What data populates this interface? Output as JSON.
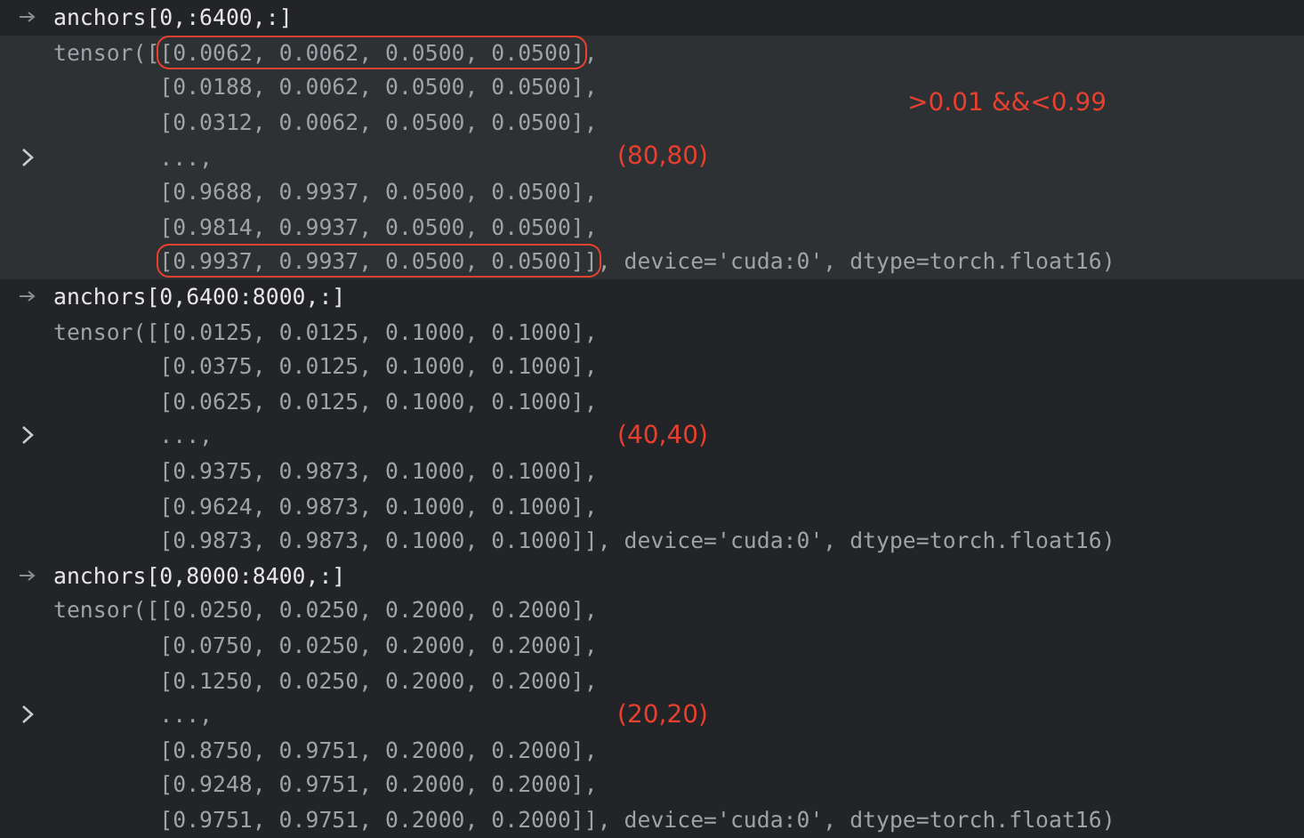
{
  "cells": [
    {
      "input": "anchors[0,:6400,:]",
      "selected": true,
      "side_note": ">0.01 &&<0.99",
      "lines": [
        {
          "lead": "tensor([",
          "body": "[0.0062, 0.0062, 0.0500, 0.0500]",
          "tail": ",",
          "boxed": true
        },
        {
          "body": "[0.0188, 0.0062, 0.0500, 0.0500]",
          "tail": ",",
          "boxed": false
        },
        {
          "body": "[0.0312, 0.0062, 0.0500, 0.0500]",
          "tail": ",",
          "boxed": false
        },
        {
          "body": "...,",
          "boxed": false,
          "expander": true,
          "note": "(80,80)"
        },
        {
          "body": "[0.9688, 0.9937, 0.0500, 0.0500]",
          "tail": ",",
          "boxed": false
        },
        {
          "body": "[0.9814, 0.9937, 0.0500, 0.0500]",
          "tail": ",",
          "boxed": false
        },
        {
          "body": "[0.9937, 0.9937, 0.0500, 0.0500]]",
          "tail": ", device='cuda:0', dtype=torch.float16)",
          "boxed": true
        }
      ]
    },
    {
      "input": "anchors[0,6400:8000,:]",
      "selected": false,
      "lines": [
        {
          "lead": "tensor([",
          "body": "[0.0125, 0.0125, 0.1000, 0.1000]",
          "tail": ",",
          "boxed": false
        },
        {
          "body": "[0.0375, 0.0125, 0.1000, 0.1000]",
          "tail": ",",
          "boxed": false
        },
        {
          "body": "[0.0625, 0.0125, 0.1000, 0.1000]",
          "tail": ",",
          "boxed": false
        },
        {
          "body": "...,",
          "boxed": false,
          "expander": true,
          "note": "(40,40)"
        },
        {
          "body": "[0.9375, 0.9873, 0.1000, 0.1000]",
          "tail": ",",
          "boxed": false
        },
        {
          "body": "[0.9624, 0.9873, 0.1000, 0.1000]",
          "tail": ",",
          "boxed": false
        },
        {
          "body": "[0.9873, 0.9873, 0.1000, 0.1000]]",
          "tail": ", device='cuda:0', dtype=torch.float16)",
          "boxed": false
        }
      ]
    },
    {
      "input": "anchors[0,8000:8400,:]",
      "selected": false,
      "lines": [
        {
          "lead": "tensor([",
          "body": "[0.0250, 0.0250, 0.2000, 0.2000]",
          "tail": ",",
          "boxed": false
        },
        {
          "body": "[0.0750, 0.0250, 0.2000, 0.2000]",
          "tail": ",",
          "boxed": false
        },
        {
          "body": "[0.1250, 0.0250, 0.2000, 0.2000]",
          "tail": ",",
          "boxed": false
        },
        {
          "body": "...,",
          "boxed": false,
          "expander": true,
          "note": "(20,20)"
        },
        {
          "body": "[0.8750, 0.9751, 0.2000, 0.2000]",
          "tail": ",",
          "boxed": false
        },
        {
          "body": "[0.9248, 0.9751, 0.2000, 0.2000]",
          "tail": ",",
          "boxed": false
        },
        {
          "body": "[0.9751, 0.9751, 0.2000, 0.2000]]",
          "tail": ", device='cuda:0', dtype=torch.float16)",
          "boxed": false
        }
      ]
    }
  ]
}
